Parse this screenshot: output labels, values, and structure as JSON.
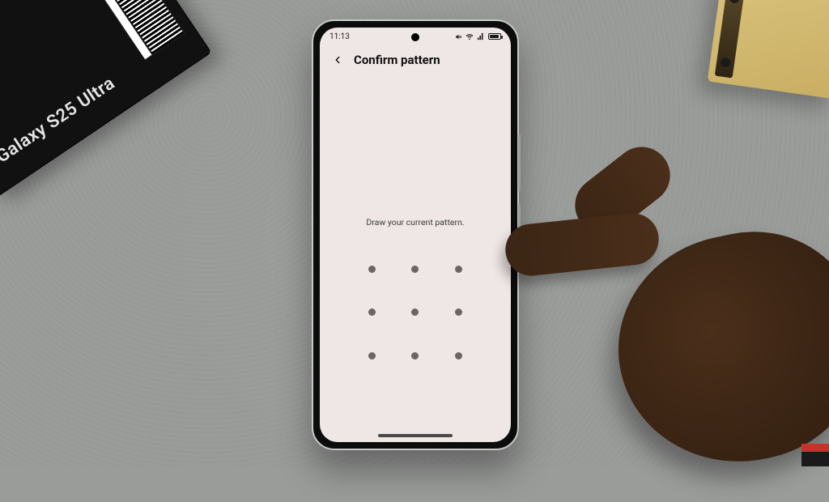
{
  "statusbar": {
    "time": "11:13",
    "battery_percent": "84"
  },
  "header": {
    "title": "Confirm pattern"
  },
  "instruction": "Draw your current pattern.",
  "product_box_label": "Galaxy S25 Ultra"
}
